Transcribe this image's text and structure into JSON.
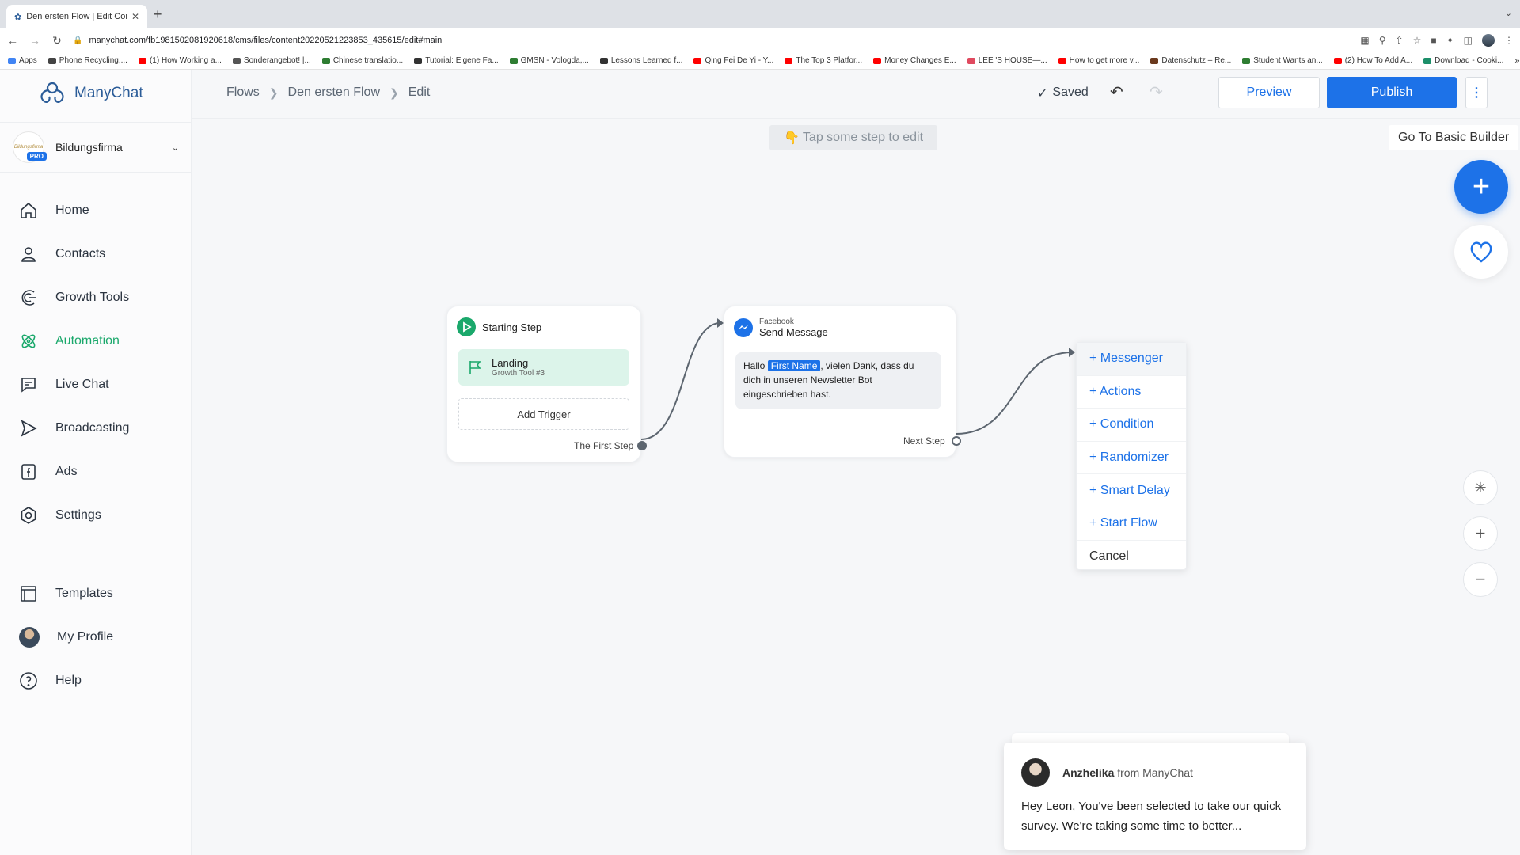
{
  "browser": {
    "tab_title": "Den ersten Flow | Edit Content",
    "url": "manychat.com/fb198150208192061​8/cms/files/content20220521223853_435615/edit#main",
    "bookmarks": [
      {
        "label": "Apps",
        "color": "#4285f4"
      },
      {
        "label": "Phone Recycling,...",
        "color": "#444444"
      },
      {
        "label": "(1) How Working a...",
        "color": "#ff0000"
      },
      {
        "label": "Sonderangebot! |...",
        "color": "#555555"
      },
      {
        "label": "Chinese translatio...",
        "color": "#2e7d32"
      },
      {
        "label": "Tutorial: Eigene Fa...",
        "color": "#333333"
      },
      {
        "label": "GMSN - Vologda,...",
        "color": "#2e7d32"
      },
      {
        "label": "Lessons Learned f...",
        "color": "#333333"
      },
      {
        "label": "Qing Fei De Yi - Y...",
        "color": "#ff0000"
      },
      {
        "label": "The Top 3 Platfor...",
        "color": "#ff0000"
      },
      {
        "label": "Money Changes E...",
        "color": "#ff0000"
      },
      {
        "label": "LEE 'S HOUSE—...",
        "color": "#e04a5f"
      },
      {
        "label": "How to get more v...",
        "color": "#ff0000"
      },
      {
        "label": "Datenschutz – Re...",
        "color": "#6b3a1e"
      },
      {
        "label": "Student Wants an...",
        "color": "#2e7d32"
      },
      {
        "label": "(2) How To Add A...",
        "color": "#ff0000"
      },
      {
        "label": "Download - Cooki...",
        "color": "#1d8f6a"
      }
    ]
  },
  "sidebar": {
    "brand": "ManyChat",
    "account": {
      "name": "Bildungsfirma",
      "badge": "PRO",
      "logo_text": "Bildungsfirma"
    },
    "items": [
      {
        "label": "Home",
        "icon": "home-icon"
      },
      {
        "label": "Contacts",
        "icon": "contacts-icon"
      },
      {
        "label": "Growth Tools",
        "icon": "growth-tools-icon"
      },
      {
        "label": "Automation",
        "icon": "automation-icon",
        "active": true
      },
      {
        "label": "Live Chat",
        "icon": "live-chat-icon"
      },
      {
        "label": "Broadcasting",
        "icon": "broadcasting-icon"
      },
      {
        "label": "Ads",
        "icon": "ads-icon"
      },
      {
        "label": "Settings",
        "icon": "settings-icon"
      }
    ],
    "bottom_items": [
      {
        "label": "Templates",
        "icon": "templates-icon"
      },
      {
        "label": "My Profile",
        "icon": "profile-avatar"
      },
      {
        "label": "Help",
        "icon": "help-icon"
      }
    ],
    "active_color": "#1aa86b"
  },
  "header": {
    "breadcrumb": [
      "Flows",
      "Den ersten Flow",
      "Edit"
    ],
    "saved": "Saved",
    "preview": "Preview",
    "publish": "Publish",
    "accent": "#1d72e8"
  },
  "canvas": {
    "hint": "Tap some step to edit",
    "basic_builder": "Go To Basic Builder",
    "start_node": {
      "title": "Starting Step",
      "trigger_title": "Landing",
      "trigger_sub": "Growth Tool #3",
      "add_trigger": "Add Trigger",
      "output": "The First Step"
    },
    "message_node": {
      "platform": "Facebook",
      "title": "Send Message",
      "text_before": "Hallo",
      "variable": "First Name",
      "text_after": ", vielen Dank, dass du dich in unseren Newsletter Bot eingeschrieben hast.",
      "output": "Next Step"
    },
    "menu": [
      "+ Messenger",
      "+ Actions",
      "+ Condition",
      "+ Randomizer",
      "+ Smart Delay",
      "+ Start Flow",
      "Cancel"
    ]
  },
  "chat": {
    "name": "Anzhelika",
    "from": "from ManyChat",
    "message": "Hey Leon,  You've been selected to take our quick survey. We're taking some time to better..."
  }
}
